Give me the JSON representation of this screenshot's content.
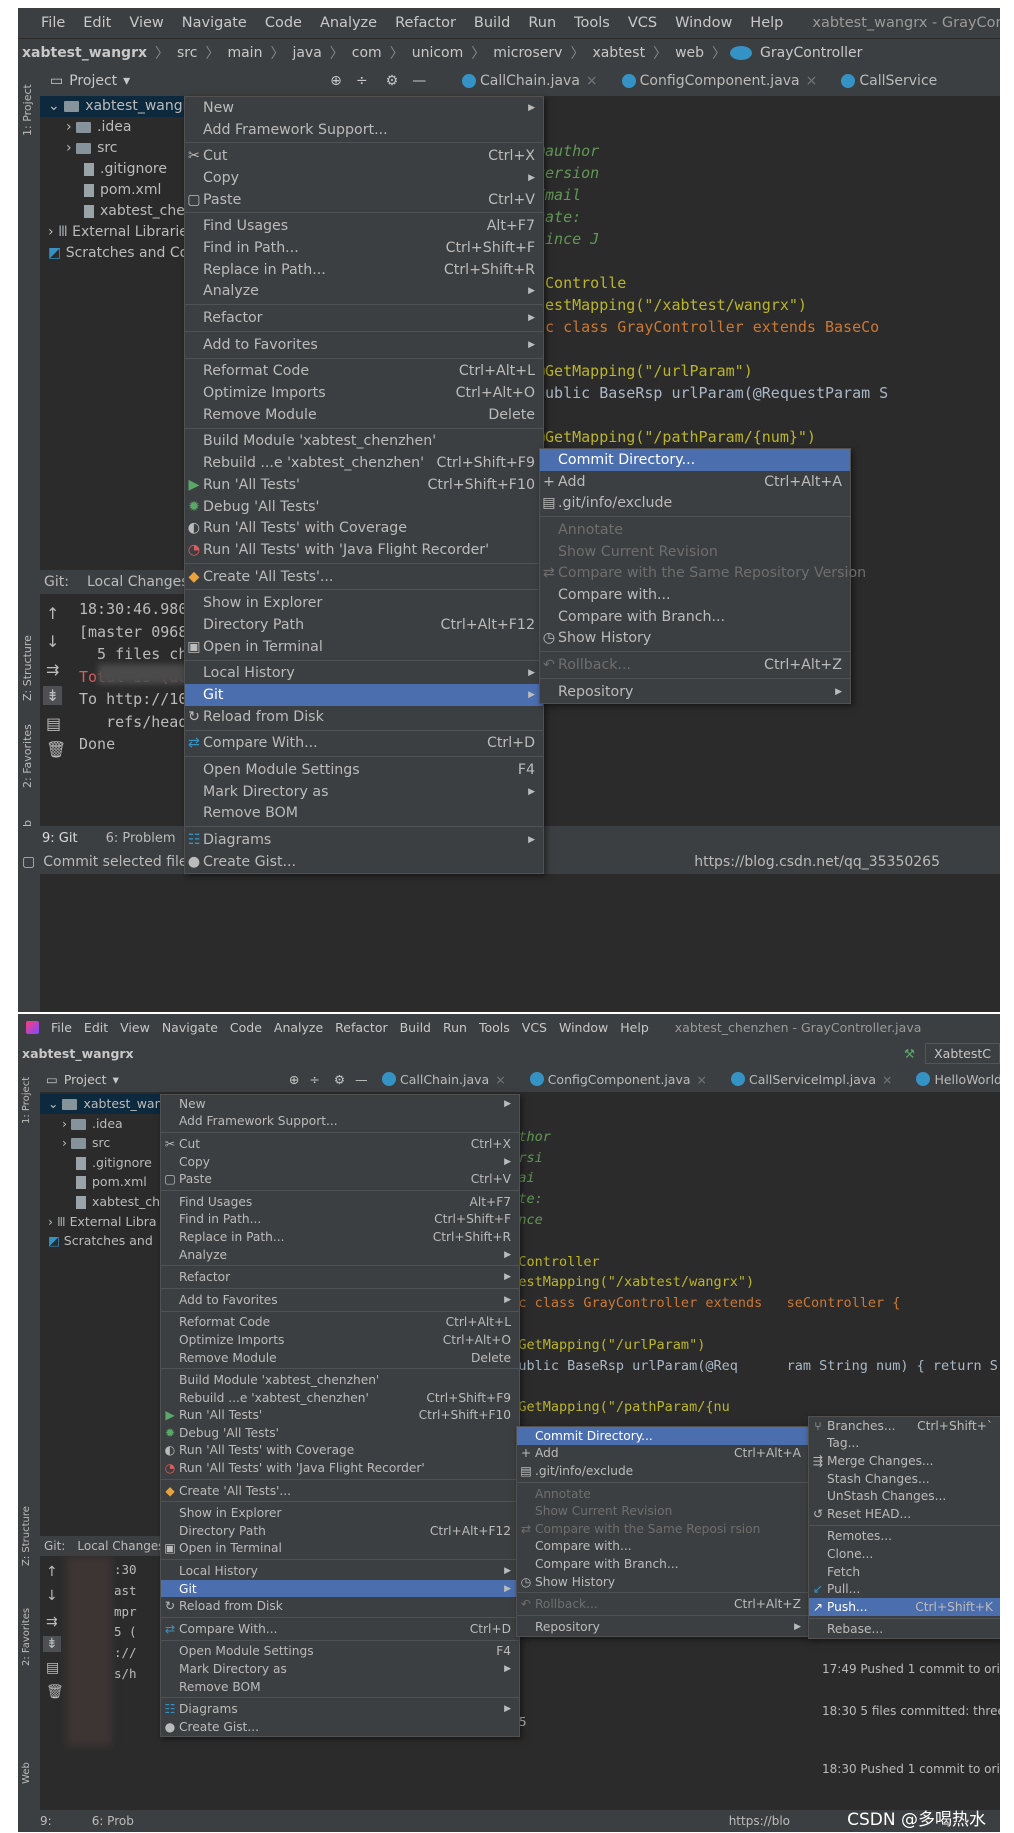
{
  "menubar": {
    "items": [
      "File",
      "Edit",
      "View",
      "Navigate",
      "Code",
      "Analyze",
      "Refactor",
      "Build",
      "Run",
      "Tools",
      "VCS",
      "Window",
      "Help"
    ],
    "title_top": "xabtest_wangrx - GrayCon",
    "title_bottom": "xabtest_chenzhen - GrayController.java"
  },
  "breadcrumb": [
    "xabtest_wangrx",
    "src",
    "main",
    "java",
    "com",
    "unicom",
    "microserv",
    "xabtest",
    "web",
    "GrayController"
  ],
  "bottom_toolbar": {
    "run_config": "XabtestC"
  },
  "project_panel": {
    "title": "Project"
  },
  "editor_tabs_top": [
    "CallChain.java",
    "ConfigComponent.java",
    "CallService"
  ],
  "editor_tabs_bottom": [
    "CallChain.java",
    "ConfigComponent.java",
    "CallServiceImpl.java",
    "HelloWorld."
  ],
  "tree_top": [
    "xabtest_wangrx [",
    "  .idea",
    "  src",
    ".gitignore",
    "pom.xml",
    "xabtest_chenz",
    "External Libraries",
    "Scratches and Co"
  ],
  "tree_bottom": [
    "xabtest_wang",
    ".idea",
    "src",
    ".gitignore",
    "pom.xml",
    "xabtest_ch",
    "External Libra",
    "Scratches and"
  ],
  "side_labels": [
    "1: Project",
    "Z: Structure",
    "2: Favorites",
    "Web"
  ],
  "code_top": [
    {
      "t": "@author",
      "c": "doc"
    },
    {
      "t": "version",
      "c": "doc"
    },
    {
      "t": "Email",
      "c": "doc"
    },
    {
      "t": "Date:",
      "c": "doc"
    },
    {
      "t": "since J",
      "c": "doc"
    },
    {
      "t": "",
      "c": ""
    },
    {
      "t": "tControlle",
      "c": "ann"
    },
    {
      "t": "uestMapping(\"/xabtest/wangrx\")",
      "c": "ann"
    },
    {
      "t": "ic class GrayController extends BaseCo",
      "c": "kw"
    },
    {
      "t": "",
      "c": ""
    },
    {
      "t": "@GetMapping(\"/urlParam\")",
      "c": "ann"
    },
    {
      "t": "public BaseRsp urlParam(@RequestParam S",
      "c": ""
    },
    {
      "t": "",
      "c": ""
    },
    {
      "t": "@GetMapping(\"/pathParam/{num}\")",
      "c": "ann"
    }
  ],
  "code_bottom": [
    {
      "t": "*",
      "c": "doc"
    },
    {
      "t": "@author",
      "c": "doc"
    },
    {
      "t": "@versi",
      "c": "doc"
    },
    {
      "t": "@Emai",
      "c": "doc"
    },
    {
      "t": "@Date:",
      "c": "doc"
    },
    {
      "t": "@since",
      "c": "doc"
    },
    {
      "t": "/",
      "c": "doc"
    },
    {
      "t": "estController",
      "c": "ann"
    },
    {
      "t": "equestMapping(\"/xabtest/wangrx\")",
      "c": "ann"
    },
    {
      "t": "blic class GrayController extends   seController {",
      "c": "kw"
    },
    {
      "t": "",
      "c": ""
    },
    {
      "t": "  @GetMapping(\"/urlParam\")",
      "c": "ann"
    },
    {
      "t": "  public BaseRsp urlParam(@Req      ram String num) { return S",
      "c": ""
    },
    {
      "t": "",
      "c": ""
    },
    {
      "t": "  @GetMapping(\"/pathParam/{nu",
      "c": "ann"
    }
  ],
  "git_panel": {
    "label": "Git:",
    "tab": "Local Changes"
  },
  "console_top": [
    "18:30:46.980:",
    "[master 09689",
    "  5 files char",
    "",
    "",
    "Total 15 (del",
    "To http://10.",
    "   refs/head",
    "Done"
  ],
  "console_bottom": [
    ":30",
    "ast",
    "",
    "",
    "",
    "mpr",
    "5 (",
    "://",
    "s/h"
  ],
  "context_menu": [
    {
      "label": "New",
      "sc": "",
      "arrow": true,
      "icon": ""
    },
    {
      "label": "Add Framework Support...",
      "sc": "",
      "icon": ""
    },
    {
      "sep": true
    },
    {
      "label": "Cut",
      "sc": "Ctrl+X",
      "icon": "✂"
    },
    {
      "label": "Copy",
      "sc": "",
      "arrow": true,
      "icon": ""
    },
    {
      "label": "Paste",
      "sc": "Ctrl+V",
      "icon": "▢"
    },
    {
      "sep": true
    },
    {
      "label": "Find Usages",
      "sc": "Alt+F7",
      "icon": ""
    },
    {
      "label": "Find in Path...",
      "sc": "Ctrl+Shift+F",
      "icon": ""
    },
    {
      "label": "Replace in Path...",
      "sc": "Ctrl+Shift+R",
      "icon": ""
    },
    {
      "label": "Analyze",
      "sc": "",
      "arrow": true,
      "icon": ""
    },
    {
      "sep": true
    },
    {
      "label": "Refactor",
      "sc": "",
      "arrow": true,
      "icon": ""
    },
    {
      "sep": true
    },
    {
      "label": "Add to Favorites",
      "sc": "",
      "arrow": true,
      "icon": ""
    },
    {
      "sep": true
    },
    {
      "label": "Reformat Code",
      "sc": "Ctrl+Alt+L",
      "icon": ""
    },
    {
      "label": "Optimize Imports",
      "sc": "Ctrl+Alt+O",
      "icon": ""
    },
    {
      "label": "Remove Module",
      "sc": "Delete",
      "icon": ""
    },
    {
      "sep": true
    },
    {
      "label": "Build Module 'xabtest_chenzhen'",
      "sc": "",
      "icon": ""
    },
    {
      "label": "Rebuild ...e 'xabtest_chenzhen'",
      "sc": "Ctrl+Shift+F9",
      "icon": ""
    },
    {
      "label": "Run 'All Tests'",
      "sc": "Ctrl+Shift+F10",
      "icon": "▶",
      "iconColor": "#59a869"
    },
    {
      "label": "Debug 'All Tests'",
      "sc": "",
      "icon": "✹",
      "iconColor": "#59a869"
    },
    {
      "label": "Run 'All Tests' with Coverage",
      "sc": "",
      "icon": "◐",
      "iconColor": "#bbbbbb"
    },
    {
      "label": "Run 'All Tests' with 'Java Flight Recorder'",
      "sc": "",
      "icon": "◔",
      "iconColor": "#db5c5c"
    },
    {
      "sep": true
    },
    {
      "label": "Create 'All Tests'...",
      "sc": "",
      "icon": "◆",
      "iconColor": "#e8a33d"
    },
    {
      "sep": true
    },
    {
      "label": "Show in Explorer",
      "sc": "",
      "icon": ""
    },
    {
      "label": "Directory Path",
      "sc": "Ctrl+Alt+F12",
      "icon": ""
    },
    {
      "label": "Open in Terminal",
      "sc": "",
      "icon": "▣"
    },
    {
      "sep": true
    },
    {
      "label": "Local History",
      "sc": "",
      "arrow": true,
      "icon": ""
    },
    {
      "label": "Git",
      "sc": "",
      "arrow": true,
      "icon": "",
      "hl": true
    },
    {
      "label": "Reload from Disk",
      "sc": "",
      "icon": "↻"
    },
    {
      "sep": true
    },
    {
      "label": "Compare With...",
      "sc": "Ctrl+D",
      "icon": "⇄",
      "iconColor": "#3592c4"
    },
    {
      "sep": true
    },
    {
      "label": "Open Module Settings",
      "sc": "F4",
      "icon": ""
    },
    {
      "label": "Mark Directory as",
      "sc": "",
      "arrow": true,
      "icon": ""
    },
    {
      "label": "Remove BOM",
      "sc": "",
      "icon": ""
    },
    {
      "sep": true
    },
    {
      "label": "Diagrams",
      "sc": "",
      "arrow": true,
      "icon": "☷",
      "iconColor": "#3592c4"
    },
    {
      "label": "Create Gist...",
      "sc": "",
      "icon": "●"
    }
  ],
  "git_submenu": [
    {
      "label": "Commit Directory...",
      "sc": "",
      "icon": "",
      "hl": true
    },
    {
      "label": "Add",
      "sc": "Ctrl+Alt+A",
      "icon": "+"
    },
    {
      "label": ".git/info/exclude",
      "sc": "",
      "icon": "▤"
    },
    {
      "sep": true
    },
    {
      "label": "Annotate",
      "sc": "",
      "icon": "",
      "dis": true
    },
    {
      "label": "Show Current Revision",
      "sc": "",
      "icon": "",
      "dis": true
    },
    {
      "label": "Compare with the Same Repository Version",
      "sc": "",
      "icon": "⇄",
      "dis": true
    },
    {
      "label": "Compare with...",
      "sc": "",
      "icon": ""
    },
    {
      "label": "Compare with Branch...",
      "sc": "",
      "icon": ""
    },
    {
      "label": "Show History",
      "sc": "",
      "icon": "◷"
    },
    {
      "sep": true
    },
    {
      "label": "Rollback...",
      "sc": "Ctrl+Alt+Z",
      "icon": "↶",
      "dis": true
    },
    {
      "sep": true
    },
    {
      "label": "Repository",
      "sc": "",
      "arrow": true,
      "icon": ""
    }
  ],
  "git_submenu_bottom_labels": [
    "Commit Directory...",
    "Add",
    ".git/info/exclude",
    "Annotate",
    "Show Current Revision",
    "Compare with the Same Reposi          rsion",
    "Compare with...",
    "Compare with Branch...",
    "Show History",
    "Rollback...",
    "Repository"
  ],
  "repository_submenu": [
    {
      "label": "Branches...",
      "sc": "Ctrl+Shift+`",
      "icon": "⑂"
    },
    {
      "label": "Tag...",
      "sc": "",
      "icon": ""
    },
    {
      "label": "Merge Changes...",
      "sc": "",
      "icon": "⇶"
    },
    {
      "label": "Stash Changes...",
      "sc": "",
      "icon": ""
    },
    {
      "label": "UnStash Changes...",
      "sc": "",
      "icon": ""
    },
    {
      "label": "Reset HEAD...",
      "sc": "",
      "icon": "↺"
    },
    {
      "sep": true
    },
    {
      "label": "Remotes...",
      "sc": "",
      "icon": ""
    },
    {
      "label": "Clone...",
      "sc": "",
      "icon": ""
    },
    {
      "label": "Fetch",
      "sc": "",
      "icon": ""
    },
    {
      "label": "Pull...",
      "sc": "",
      "icon": "↙",
      "iconColor": "#3592c4"
    },
    {
      "label": "Push...",
      "sc": "Ctrl+Shift+K",
      "icon": "↗",
      "iconColor": "#59a869",
      "hl": true
    },
    {
      "sep": true
    },
    {
      "label": "Rebase...",
      "sc": "",
      "icon": ""
    }
  ],
  "git_log": [
    "17:49 Pushed 1 commit to orig",
    "18:30 5 files committed: three",
    "18:30 Pushed 1 commit to orig"
  ],
  "console_hash": "9b5",
  "status_top": {
    "tabs": [
      "9: Git",
      "6: Problem"
    ],
    "message": "Commit selected files o",
    "url": "https://blog.csdn.net/qq_35350265"
  },
  "status_bottom": {
    "tabs": [
      "9:",
      "6: Prob"
    ],
    "url": "https://blo"
  },
  "watermark": "CSDN @多喝热水",
  "colors": {
    "bg": "#2b2b2b",
    "chrome": "#3c3f41",
    "highlight": "#4b6eaf",
    "tree_selection": "#0d293e"
  }
}
